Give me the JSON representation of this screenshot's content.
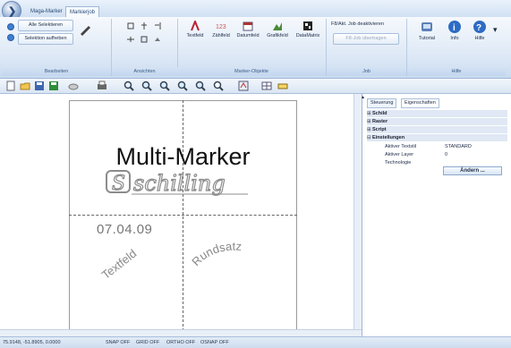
{
  "ribbon": {
    "tabs": [
      "Maga-Marker",
      "Markierjob"
    ],
    "groups": {
      "bearbeiten": {
        "label": "Bearbeiten",
        "select_all": "Alle Selektieren",
        "deselect": "Selektion aufheben"
      },
      "ansichten": {
        "label": "Ansichten"
      },
      "marker_objekte": {
        "label": "Marker-Objekte",
        "buttons": [
          "Textfeld",
          "Zählfeld",
          "Datumfeld",
          "Grafikfeld",
          "DataMatrix"
        ]
      },
      "job": {
        "label": "Job",
        "deactivate": "F8/Akt. Job deaktivieren",
        "transfer": "F8-Job übertragen"
      },
      "hilfe": {
        "label": "Hilfe",
        "buttons": [
          "Tutorial",
          "Info",
          "Hilfe"
        ]
      }
    }
  },
  "canvas": {
    "title_text": "Multi-Marker",
    "logo_text": "schilling",
    "date_text": "07.04.09",
    "textfeld_text": "Textfeld",
    "rundsatz_text": "Rundsatz"
  },
  "panel": {
    "tabs": [
      "Steuerung",
      "Eigenschaften"
    ],
    "categories": [
      "Schild",
      "Raster",
      "Script",
      "Einstellungen"
    ],
    "props": [
      {
        "key": "Aktiver Textstil",
        "value": "STANDARD"
      },
      {
        "key": "Aktiver Layer",
        "value": "0"
      },
      {
        "key": "Technologie",
        "value": ""
      }
    ],
    "andern": "Ändern ..."
  },
  "status": {
    "coords": "75.9148, -51.8905, 0.0000",
    "snap": "SNAP OFF",
    "grid": "GRID OFF",
    "ortho": "ORTHO OFF",
    "osnap": "OSNAP OFF"
  }
}
